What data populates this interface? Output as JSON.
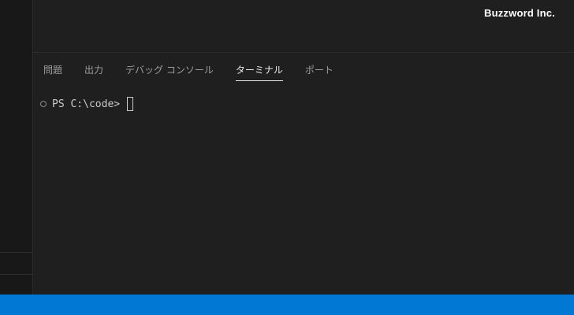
{
  "watermark": "Buzzword Inc.",
  "panel": {
    "tabs": [
      {
        "label": "問題",
        "active": false
      },
      {
        "label": "出力",
        "active": false
      },
      {
        "label": "デバッグ コンソール",
        "active": false
      },
      {
        "label": "ターミナル",
        "active": true
      },
      {
        "label": "ポート",
        "active": false
      }
    ]
  },
  "terminal": {
    "prompt": "PS C:\\code>"
  },
  "colors": {
    "background": "#1f1f1f",
    "sidebar": "#181818",
    "status_bar": "#0078d4",
    "active_tab": "#e7e7e7",
    "inactive_tab": "#9d9d9d"
  }
}
